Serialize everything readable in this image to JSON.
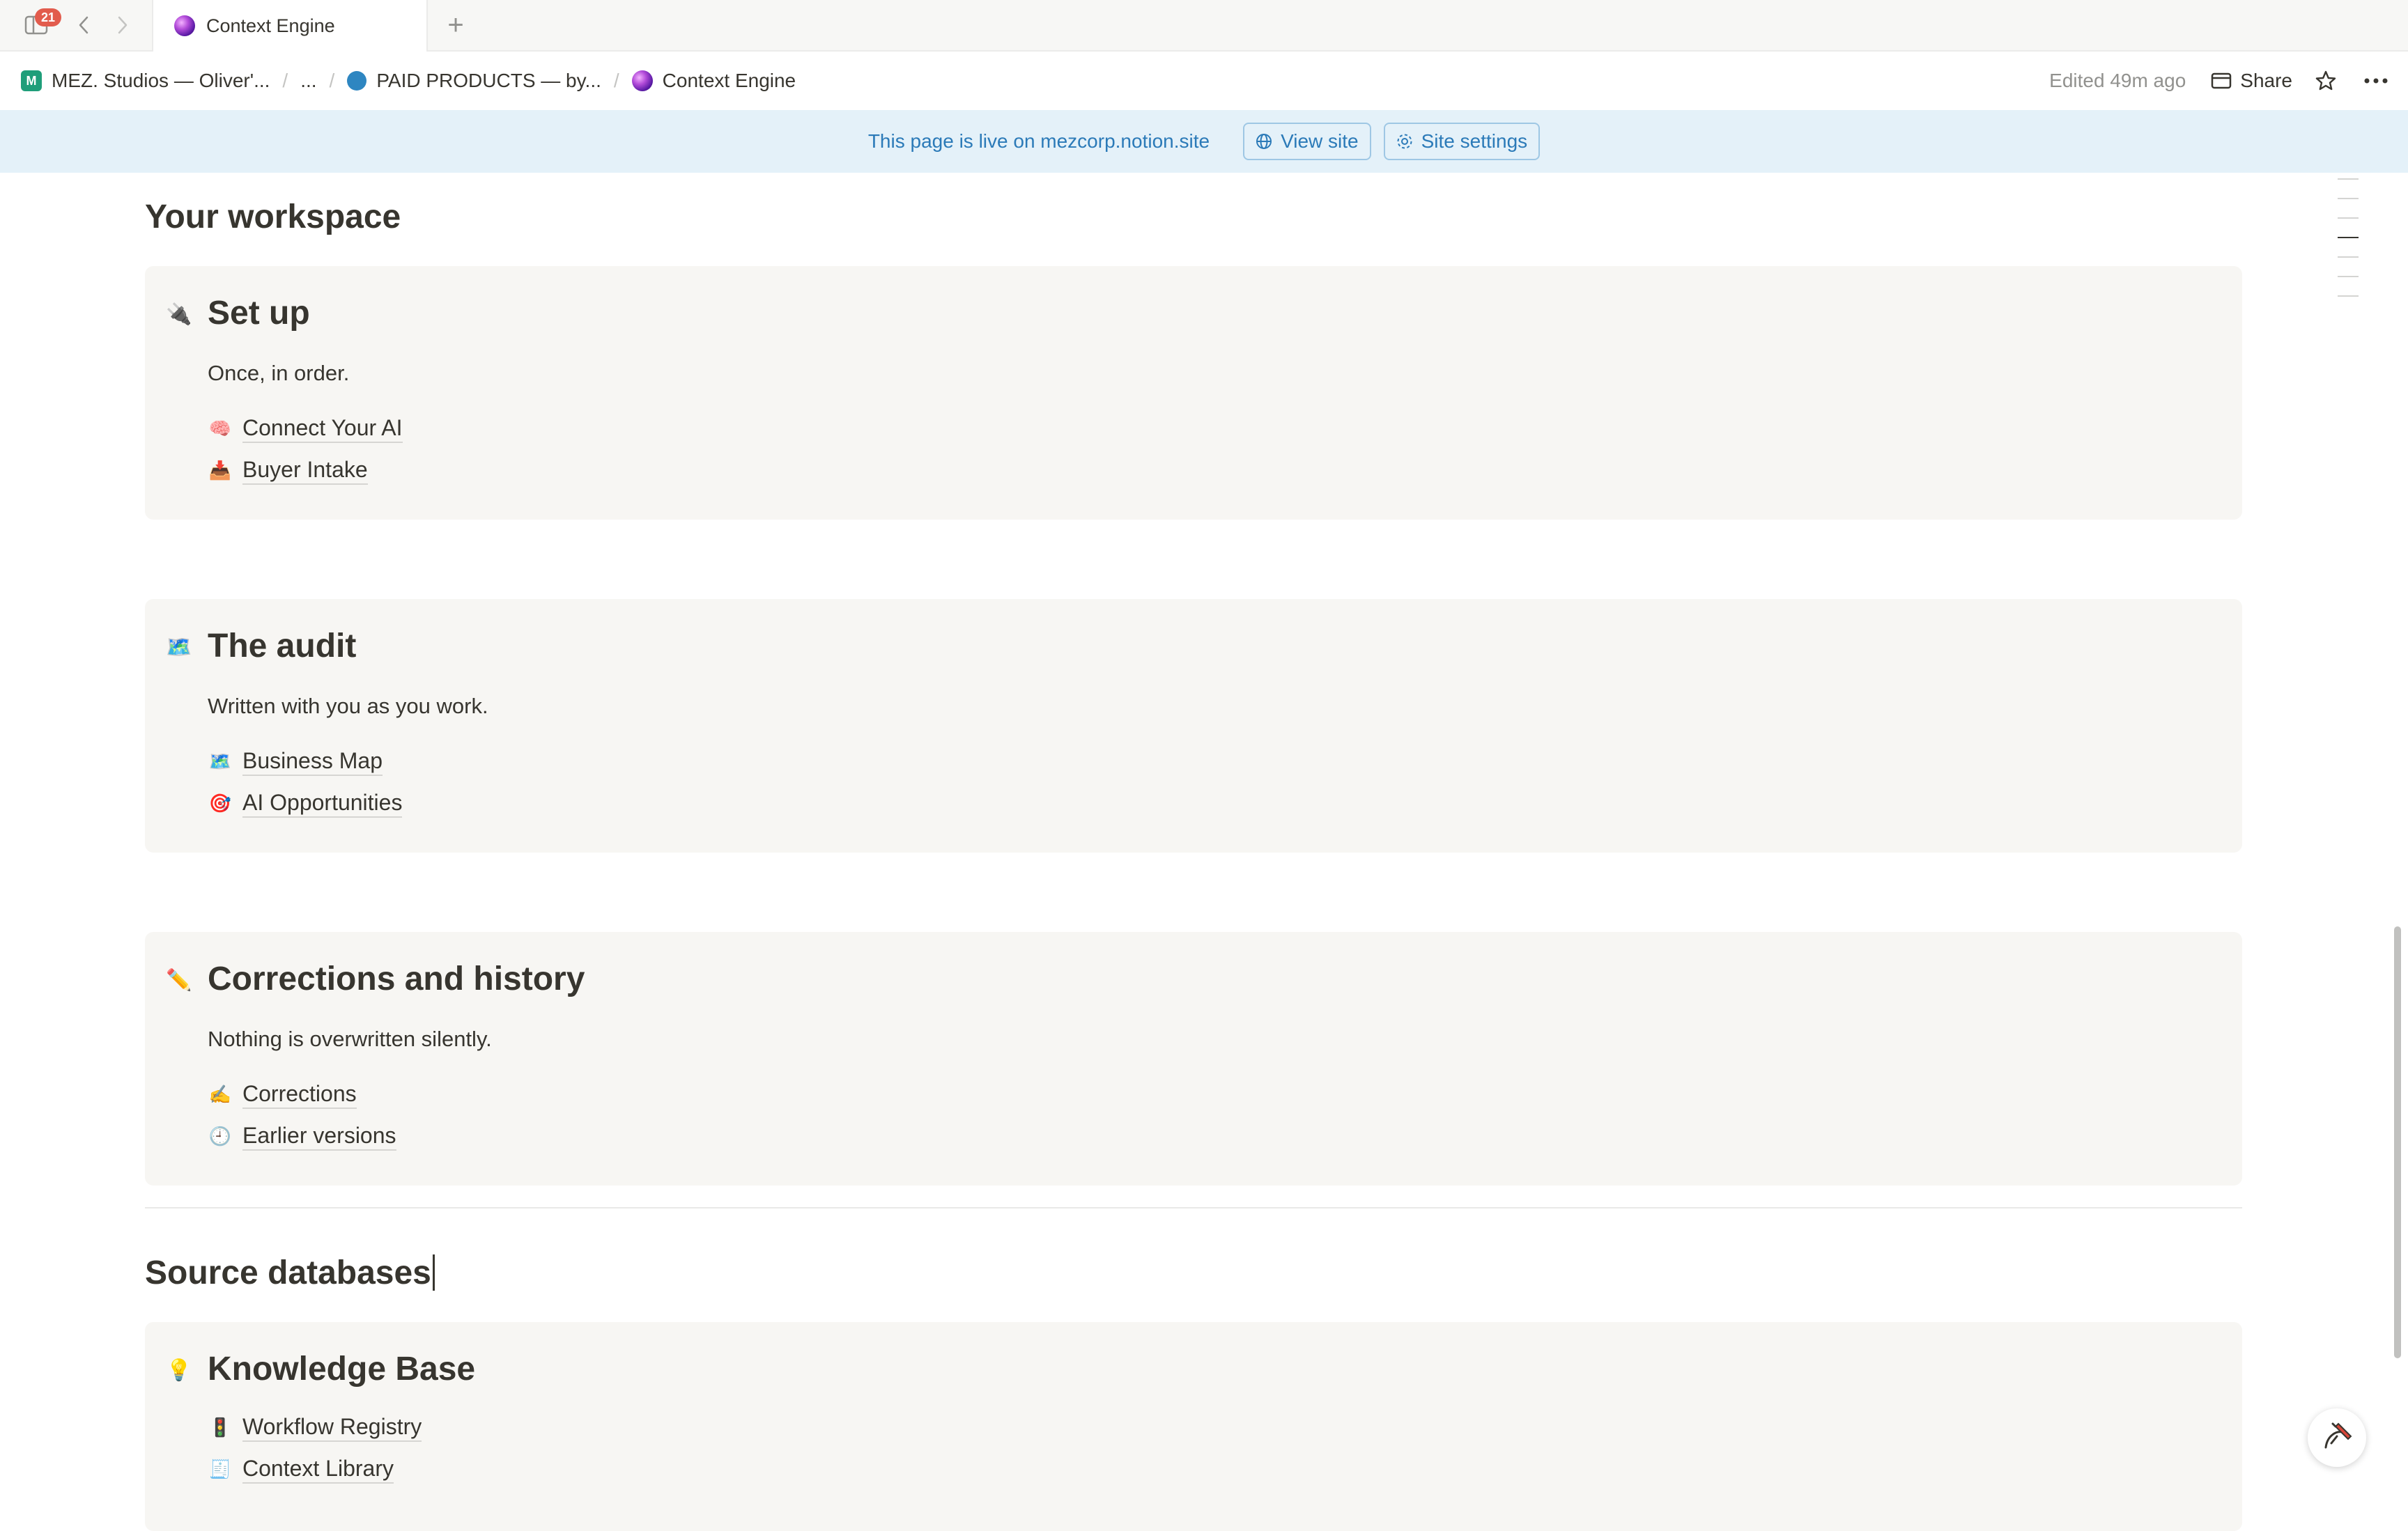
{
  "tabbar": {
    "notification_count": "21",
    "active_tab_title": "Context Engine",
    "new_tab_symbol": "+"
  },
  "breadcrumb": {
    "items": [
      "MEZ. Studios — Oliver'...",
      "...",
      "PAID PRODUCTS — by...",
      "Context Engine"
    ],
    "separator": "/"
  },
  "topbar": {
    "edited": "Edited 49m ago",
    "share_label": "Share"
  },
  "banner": {
    "text": "This page is live on mezcorp.notion.site",
    "view_site_label": "View site",
    "site_settings_label": "Site settings"
  },
  "content": {
    "workspace_heading": "Your workspace",
    "cards": [
      {
        "icon": "🔌",
        "title": "Set up",
        "subtitle": "Once, in order.",
        "links": [
          {
            "emoji": "🧠",
            "label": "Connect Your AI"
          },
          {
            "emoji": "📥",
            "label": "Buyer Intake"
          }
        ]
      },
      {
        "icon": "🗺️",
        "title": "The audit",
        "subtitle": "Written with you as you work.",
        "links": [
          {
            "emoji": "🗺️",
            "label": "Business Map"
          },
          {
            "emoji": "🎯",
            "label": "AI Opportunities"
          }
        ]
      },
      {
        "icon": "✏️",
        "title": "Corrections and history",
        "subtitle": "Nothing is overwritten silently.",
        "links": [
          {
            "emoji": "✍️",
            "label": "Corrections"
          },
          {
            "emoji": "🕘",
            "label": "Earlier versions"
          }
        ]
      }
    ],
    "source_heading": "Source databases",
    "knowledge_card": {
      "icon": "💡",
      "title": "Knowledge Base",
      "links": [
        {
          "emoji": "🚦",
          "label": "Workflow Registry"
        },
        {
          "emoji": "🧾",
          "label": "Context Library"
        }
      ]
    }
  },
  "colors": {
    "banner_bg": "#e4f1f9",
    "banner_text": "#2b7ab8",
    "card_bg": "#f7f6f3",
    "badge": "#e25c4d"
  },
  "icons": [
    "sidebar-toggle-icon",
    "back-arrow-icon",
    "forward-arrow-icon",
    "globe-icon",
    "gear-icon",
    "window-icon",
    "star-icon",
    "more-icon",
    "help-icon"
  ]
}
